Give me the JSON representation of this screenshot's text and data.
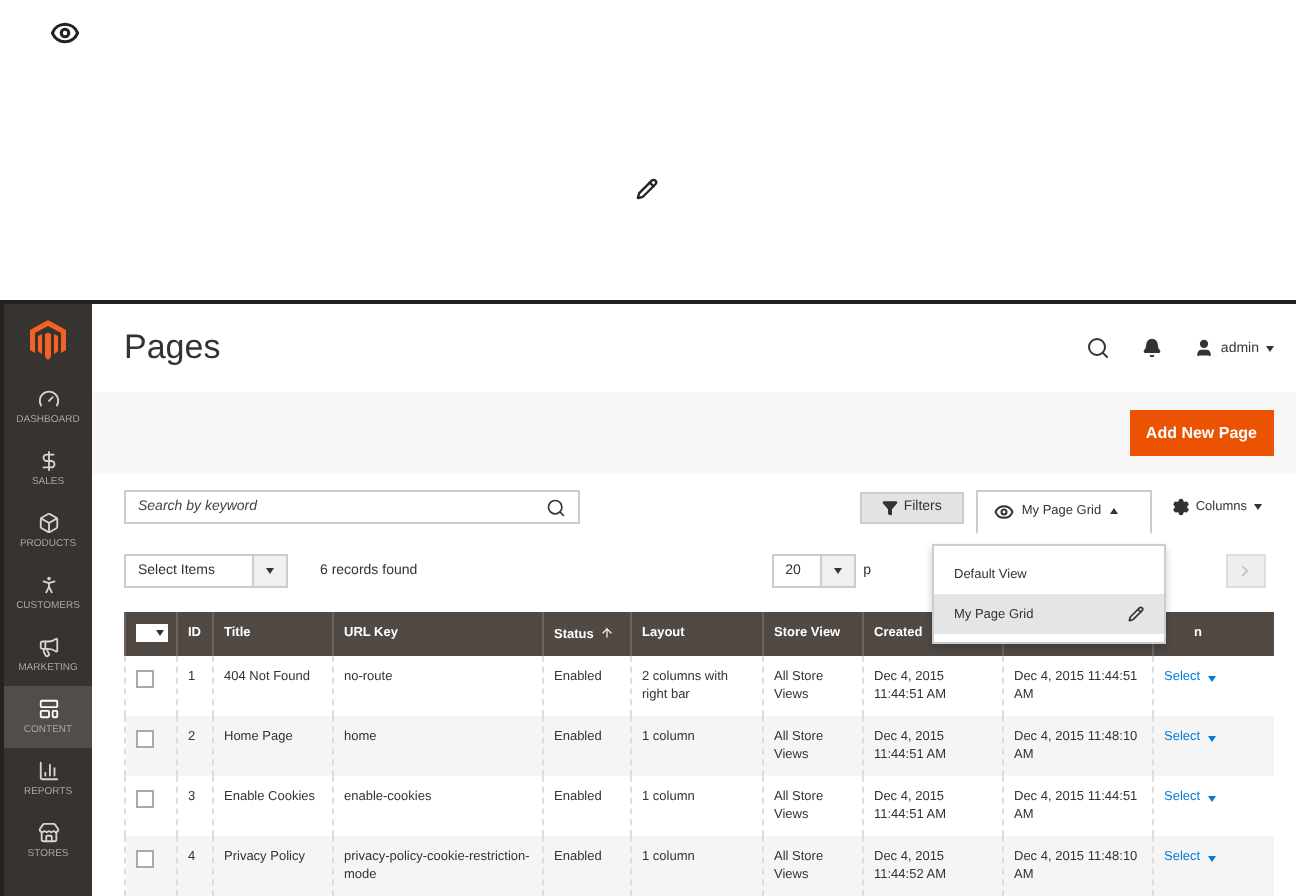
{
  "sidebar": {
    "items": [
      {
        "label": "DASHBOARD",
        "selected": false
      },
      {
        "label": "SALES",
        "selected": false
      },
      {
        "label": "PRODUCTS",
        "selected": false
      },
      {
        "label": "CUSTOMERS",
        "selected": false
      },
      {
        "label": "MARKETING",
        "selected": false
      },
      {
        "label": "CONTENT",
        "selected": true
      },
      {
        "label": "REPORTS",
        "selected": false
      },
      {
        "label": "STORES",
        "selected": false
      }
    ]
  },
  "page": {
    "title": "Pages",
    "user": "admin",
    "add_button": "Add New Page"
  },
  "toolbar": {
    "search_placeholder": "Search by keyword",
    "filters": "Filters",
    "view": {
      "label": "My Page Grid",
      "expanded": true,
      "items": [
        {
          "label": "Default View",
          "selected": false
        },
        {
          "label": "My Page Grid",
          "selected": true
        }
      ]
    },
    "columns": "Columns"
  },
  "actions_bar": {
    "mass_action": "Select Items",
    "records": "6 records found",
    "per_page": "20",
    "per_page_label": "p"
  },
  "table": {
    "mass_select": {
      "checked": false
    },
    "columns": [
      {
        "label": "ID",
        "sorted": false
      },
      {
        "label": "Title",
        "sorted": false
      },
      {
        "label": "URL Key",
        "sorted": false
      },
      {
        "label": "Status",
        "sorted": true
      },
      {
        "label": "Layout",
        "sorted": false
      },
      {
        "label": "Store View",
        "sorted": false
      },
      {
        "label": "Created",
        "sorted": false
      },
      {
        "sorted": false
      },
      {
        "label": "n",
        "sorted": false
      }
    ],
    "rows": [
      {
        "checked": false,
        "cells": [
          "1",
          "404 Not Found",
          "no-route",
          "Enabled",
          "2 columns with right bar",
          "All Store Views",
          "Dec 4, 2015 11:44:51 AM",
          "Dec 4, 2015 11:44:51 AM"
        ],
        "action": "Select"
      },
      {
        "checked": false,
        "cells": [
          "2",
          "Home Page",
          "home",
          "Enabled",
          "1 column",
          "All Store Views",
          "Dec 4, 2015 11:44:51 AM",
          "Dec 4, 2015 11:48:10 AM"
        ],
        "action": "Select"
      },
      {
        "checked": false,
        "cells": [
          "3",
          "Enable Cookies",
          "enable-cookies",
          "Enabled",
          "1 column",
          "All Store Views",
          "Dec 4, 2015 11:44:51 AM",
          "Dec 4, 2015 11:44:51 AM"
        ],
        "action": "Select"
      },
      {
        "checked": false,
        "cells": [
          "4",
          "Privacy Policy",
          "privacy-policy-cookie-restriction-mode",
          "Enabled",
          "1 column",
          "All Store Views",
          "Dec 4, 2015 11:44:52 AM",
          "Dec 4, 2015 11:48:10 AM"
        ],
        "action": "Select"
      }
    ]
  }
}
